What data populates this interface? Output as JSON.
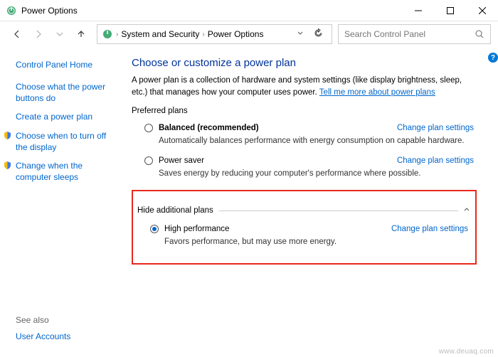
{
  "window": {
    "title": "Power Options"
  },
  "breadcrumb": {
    "seg1": "System and Security",
    "seg2": "Power Options"
  },
  "search": {
    "placeholder": "Search Control Panel"
  },
  "sidebar": {
    "home": "Control Panel Home",
    "links": [
      "Choose what the power buttons do",
      "Create a power plan",
      "Choose when to turn off the display",
      "Change when the computer sleeps"
    ],
    "seealso_label": "See also",
    "seealso_link": "User Accounts"
  },
  "main": {
    "heading": "Choose or customize a power plan",
    "desc_pre": "A power plan is a collection of hardware and system settings (like display brightness, sleep, etc.) that manages how your computer uses power. ",
    "desc_link": "Tell me more about power plans",
    "preferred_label": "Preferred plans",
    "change_link": "Change plan settings",
    "collapse_label": "Hide additional plans",
    "plans": {
      "balanced": {
        "name": "Balanced (recommended)",
        "desc": "Automatically balances performance with energy consumption on capable hardware."
      },
      "powersaver": {
        "name": "Power saver",
        "desc": "Saves energy by reducing your computer's performance where possible."
      },
      "highperf": {
        "name": "High performance",
        "desc": "Favors performance, but may use more energy."
      }
    }
  },
  "watermark": "www.deuaq.com"
}
